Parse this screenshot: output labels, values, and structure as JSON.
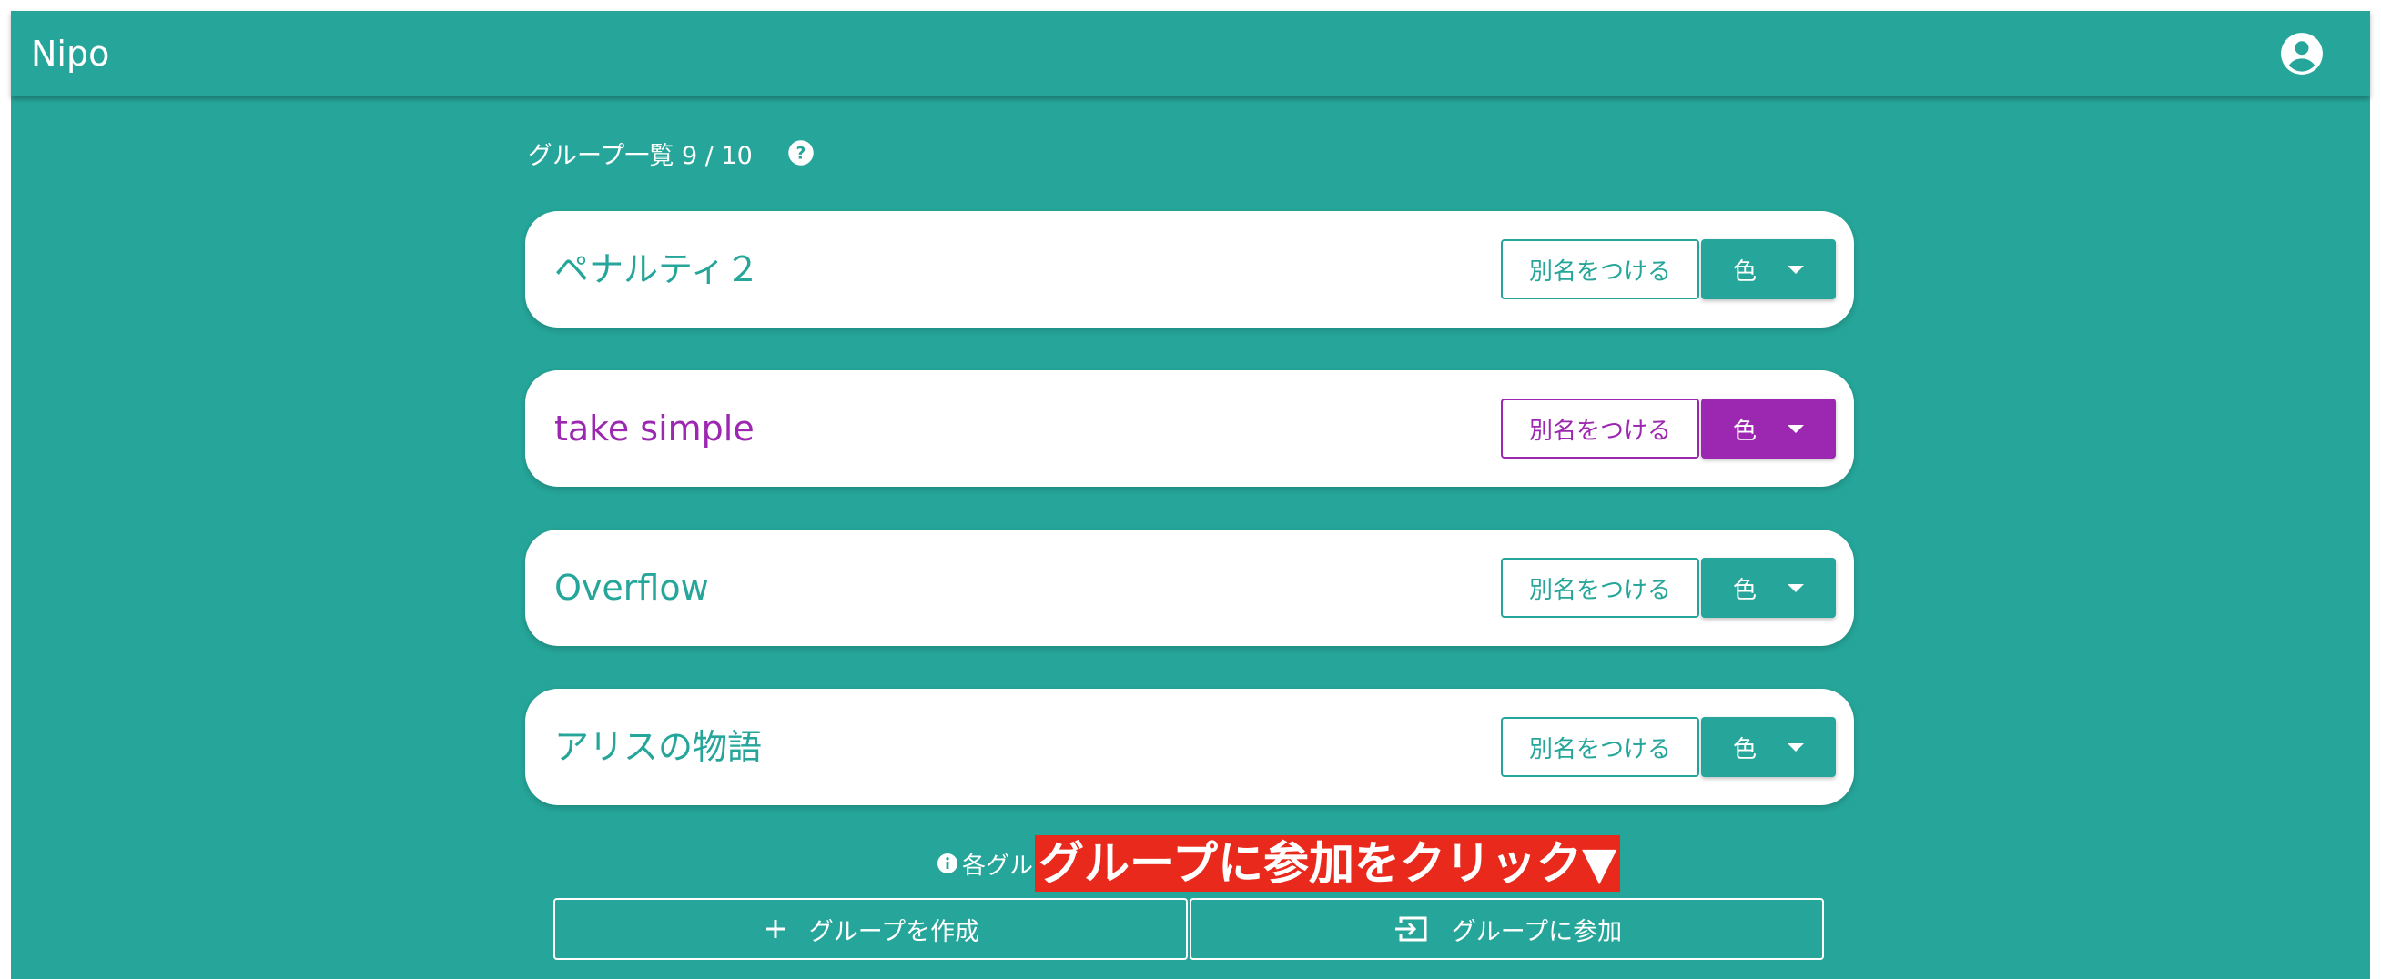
{
  "app": {
    "title": "Nipo",
    "account_icon": "account-circle-icon",
    "colors": {
      "primary": "#26a69a",
      "purple": "#9c27b0",
      "callout": "#e8291b"
    }
  },
  "group_list": {
    "header": "グループ一覧 9 / 10",
    "help_icon": "help-circle-icon",
    "groups": [
      {
        "name": "ペナルティ２",
        "alias_label": "別名をつける",
        "color_label": "色",
        "color": "#26a69a"
      },
      {
        "name": "take simple",
        "alias_label": "別名をつける",
        "color_label": "色",
        "color": "#9c27b0"
      },
      {
        "name": "Overflow",
        "alias_label": "別名をつける",
        "color_label": "色",
        "color": "#26a69a"
      },
      {
        "name": "アリスの物語",
        "alias_label": "別名をつける",
        "color_label": "色",
        "color": "#26a69a"
      }
    ]
  },
  "info": {
    "icon": "info-icon",
    "text": "各グル",
    "callout": "グループに参加をクリック▼"
  },
  "actions": {
    "create_label": "グループを作成",
    "create_icon": "plus-icon",
    "join_label": "グループに参加",
    "join_icon": "login-icon"
  }
}
